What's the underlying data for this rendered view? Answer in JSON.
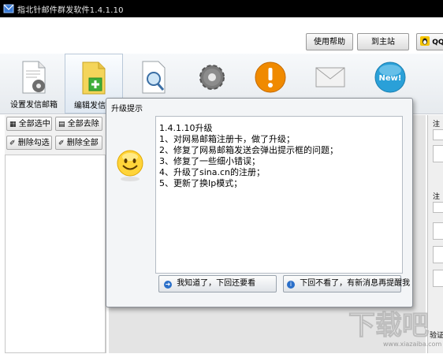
{
  "window": {
    "title": "指北针邮件群发软件1.4.1.10"
  },
  "top_buttons": {
    "help": "使用帮助",
    "site": "到主站",
    "qq": "QQ"
  },
  "toolbar": {
    "items": [
      {
        "label": "设置发信邮箱",
        "icon": "document-gear-icon"
      },
      {
        "label": "编辑发信内",
        "icon": "document-add-icon"
      },
      {
        "label": "",
        "icon": "document-search-icon"
      },
      {
        "label": "",
        "icon": "gear-icon"
      },
      {
        "label": "",
        "icon": "warning-icon"
      },
      {
        "label": "",
        "icon": "envelope-icon"
      },
      {
        "label": "",
        "icon": "new-badge-icon"
      }
    ]
  },
  "left_panel": {
    "select_all": "全部选中",
    "deselect_all": "全部去除",
    "delete_checked": "删除勾选",
    "delete_all": "删除全部"
  },
  "right_panel": {
    "label1": "注",
    "label2": "注",
    "label3": "验证"
  },
  "dialog": {
    "title": "升级提示",
    "lines": [
      "1.4.1.10升级",
      "1、对网易邮箱注册卡，做了升级；",
      "2、修复了网易邮箱发送会弹出提示框的问题；",
      "3、修复了一些细小错误；",
      "4、升级了sina.cn的注册；",
      "5、更新了换Ip模式；"
    ],
    "btn_later": "我知道了，下回还要看",
    "btn_never": "下回不看了，有新消息再提醒我"
  },
  "watermark": {
    "text": "下载吧",
    "url": "www.xiazaiba.com"
  },
  "colors": {
    "titlebar": "#000000",
    "accent": "#2a6fc9",
    "toolbar_bg": "#eef1f4"
  }
}
